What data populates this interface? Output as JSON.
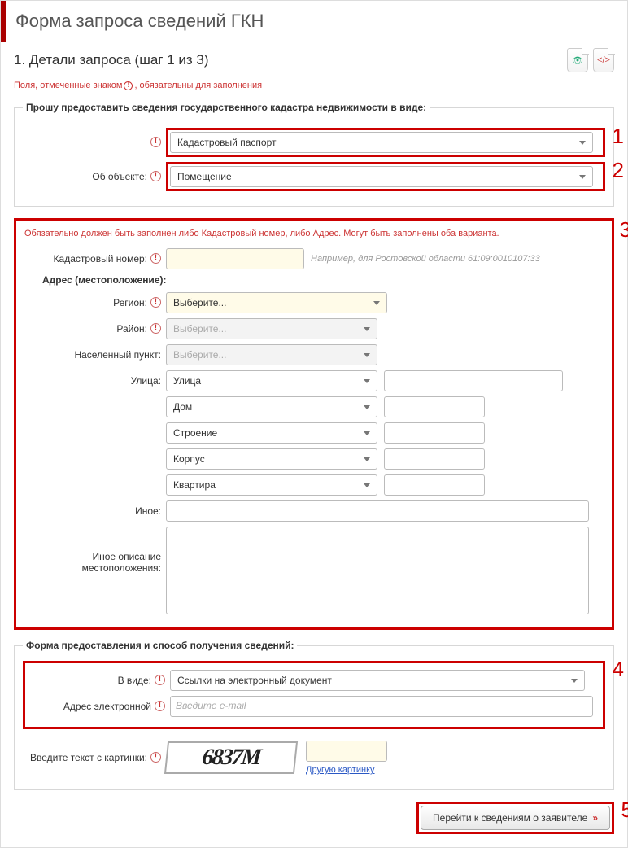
{
  "title": "Форма запроса сведений ГКН",
  "step_title": "1. Детали запроса (шаг 1 из 3)",
  "required_hint_before": "Поля, отмеченные знаком",
  "required_hint_after": ", обязательны для заполнения",
  "annotations": {
    "a1": "1",
    "a2": "2",
    "a3": "3",
    "a4": "4",
    "a5": "5"
  },
  "fieldset1": {
    "legend": "Прошу предоставить сведения государственного кадастра недвижимости в виде:",
    "doc_type_value": "Кадастровый паспорт",
    "object_label": "Об объекте:",
    "object_value": "Помещение"
  },
  "section": {
    "warning": "Обязательно должен быть заполнен либо Кадастровый номер, либо Адрес. Могут быть заполнены оба варианта.",
    "kad_label": "Кадастровый номер:",
    "kad_hint": "Например, для Ростовской области 61:09:0010107:33",
    "addr_label": "Адрес (местоположение):",
    "region_label": "Регион:",
    "region_value": "Выберите...",
    "district_label": "Район:",
    "district_value": "Выберите...",
    "city_label": "Населенный пункт:",
    "city_value": "Выберите...",
    "street_label": "Улица:",
    "street_value": "Улица",
    "house_value": "Дом",
    "building_value": "Строение",
    "corpus_value": "Корпус",
    "flat_value": "Квартира",
    "other_label": "Иное:",
    "other_desc_label1": "Иное описание",
    "other_desc_label2": "местоположения:"
  },
  "fieldset2": {
    "legend": "Форма предоставления и способ получения сведений:",
    "format_label": "В виде:",
    "format_value": "Ссылки на электронный документ",
    "email_label": "Адрес электронной",
    "email_placeholder": "Введите e-mail"
  },
  "captcha": {
    "label": "Введите текст с картинки:",
    "img_text": "6837M",
    "link": "Другую картинку"
  },
  "submit_label": "Перейти к сведениям о заявителе"
}
